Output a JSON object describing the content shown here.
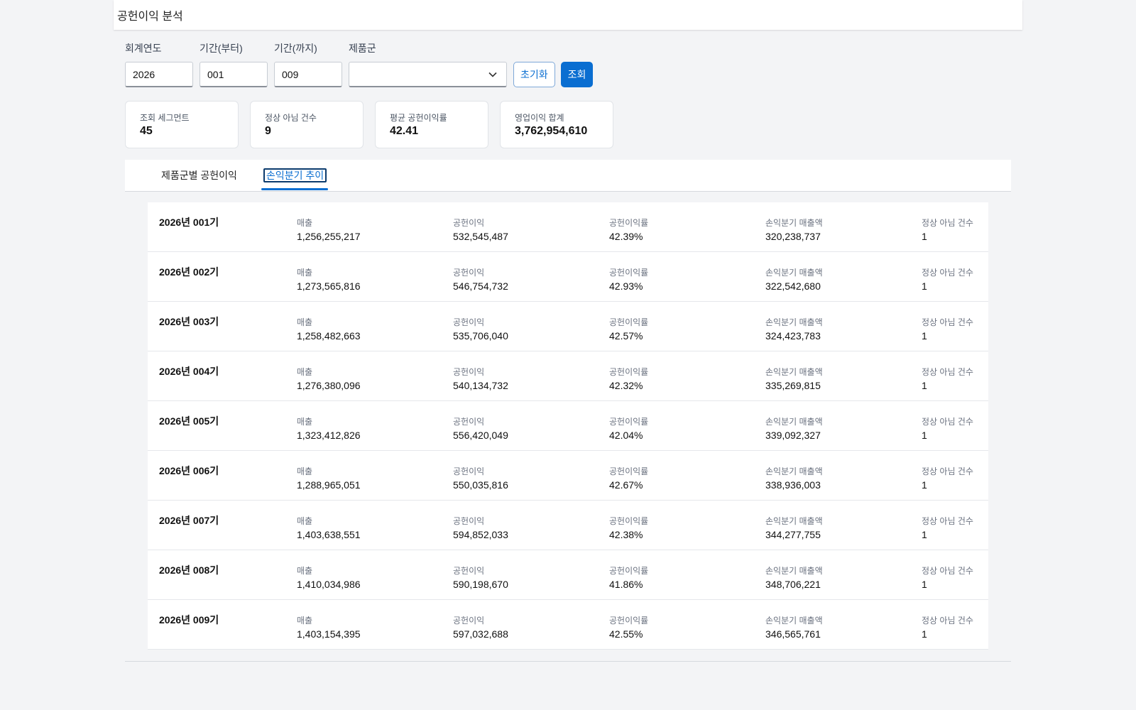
{
  "header": {
    "title": "공헌이익 분석"
  },
  "filters": {
    "year": {
      "label": "회계연도",
      "value": "2026"
    },
    "from": {
      "label": "기간(부터)",
      "value": "001"
    },
    "to": {
      "label": "기간(까지)",
      "value": "009"
    },
    "product_group": {
      "label": "제품군",
      "value": ""
    },
    "reset_label": "초기화",
    "search_label": "조회"
  },
  "kpis": [
    {
      "label": "조회 세그먼트",
      "value": "45"
    },
    {
      "label": "정상 아님 건수",
      "value": "9"
    },
    {
      "label": "평균 공헌이익률",
      "value": "42.41"
    },
    {
      "label": "영업이익 합계",
      "value": "3,762,954,610"
    }
  ],
  "tabs": [
    {
      "label": "제품군별 공헌이익"
    },
    {
      "label": "손익분기 추이"
    }
  ],
  "metric_labels": {
    "sales": "매출",
    "contribution": "공헌이익",
    "margin": "공헌이익률",
    "breakeven": "손익분기 매출액",
    "abnormal": "정상 아님 건수"
  },
  "rows": [
    {
      "period": "2026년 001기",
      "sales": "1,256,255,217",
      "contribution": "532,545,487",
      "margin": "42.39%",
      "breakeven": "320,238,737",
      "abnormal": "1"
    },
    {
      "period": "2026년 002기",
      "sales": "1,273,565,816",
      "contribution": "546,754,732",
      "margin": "42.93%",
      "breakeven": "322,542,680",
      "abnormal": "1"
    },
    {
      "period": "2026년 003기",
      "sales": "1,258,482,663",
      "contribution": "535,706,040",
      "margin": "42.57%",
      "breakeven": "324,423,783",
      "abnormal": "1"
    },
    {
      "period": "2026년 004기",
      "sales": "1,276,380,096",
      "contribution": "540,134,732",
      "margin": "42.32%",
      "breakeven": "335,269,815",
      "abnormal": "1"
    },
    {
      "period": "2026년 005기",
      "sales": "1,323,412,826",
      "contribution": "556,420,049",
      "margin": "42.04%",
      "breakeven": "339,092,327",
      "abnormal": "1"
    },
    {
      "period": "2026년 006기",
      "sales": "1,288,965,051",
      "contribution": "550,035,816",
      "margin": "42.67%",
      "breakeven": "338,936,003",
      "abnormal": "1"
    },
    {
      "period": "2026년 007기",
      "sales": "1,403,638,551",
      "contribution": "594,852,033",
      "margin": "42.38%",
      "breakeven": "344,277,755",
      "abnormal": "1"
    },
    {
      "period": "2026년 008기",
      "sales": "1,410,034,986",
      "contribution": "590,198,670",
      "margin": "41.86%",
      "breakeven": "348,706,221",
      "abnormal": "1"
    },
    {
      "period": "2026년 009기",
      "sales": "1,403,154,395",
      "contribution": "597,032,688",
      "margin": "42.55%",
      "breakeven": "346,565,761",
      "abnormal": "1"
    }
  ]
}
